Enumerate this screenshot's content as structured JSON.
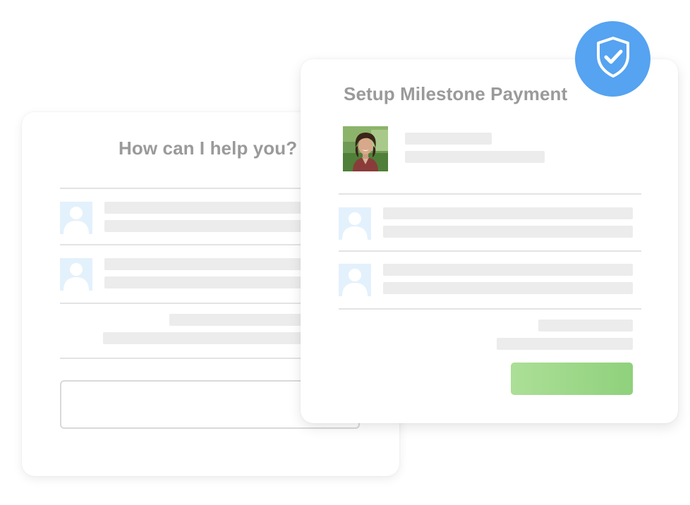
{
  "back_card": {
    "title": "How can I help you?"
  },
  "front_card": {
    "title": "Setup Milestone Payment"
  },
  "icons": {
    "shield": "shield-check-icon",
    "user_placeholder": "user-placeholder-icon"
  },
  "colors": {
    "title_text": "#9a9a9a",
    "placeholder_bar": "#ececec",
    "divider": "#e3e3e3",
    "user_placeholder_bg": "#e3f1fc",
    "shield_badge": "#55a3f1",
    "confirm_button": "#8fd17c"
  }
}
